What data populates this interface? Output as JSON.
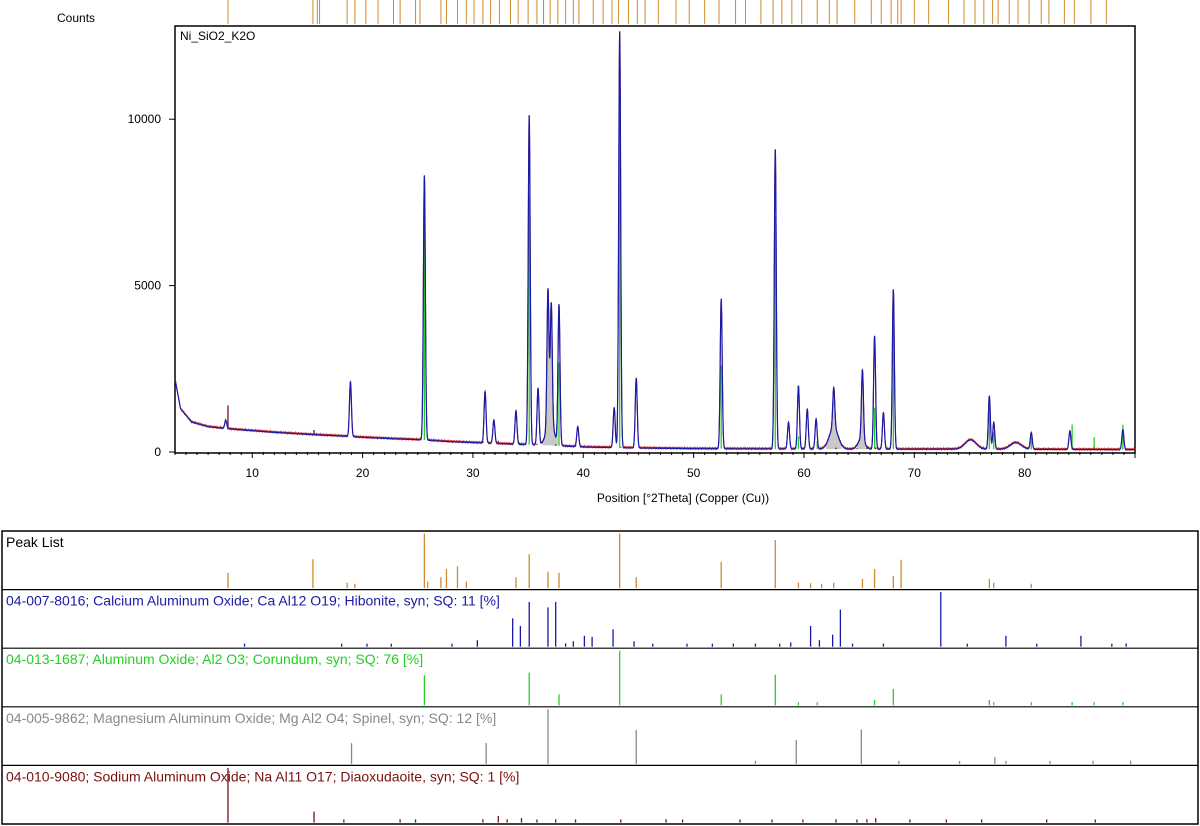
{
  "chart_data": {
    "type": "line",
    "title": "Ni_SiO2_K2O",
    "ylabel": "Counts",
    "xlabel": "Position [°2Theta] (Copper (Cu))",
    "xlim": [
      3,
      90
    ],
    "ylim": [
      0,
      12800
    ],
    "xticks": [
      10,
      20,
      30,
      40,
      50,
      60,
      70,
      80
    ],
    "yticks": [
      0,
      5000,
      10000
    ],
    "grid": false,
    "colors": {
      "peak_list": "#d08a2a",
      "hibonite": "#1a1aa8",
      "corundum": "#22d122",
      "spinel": "#888888",
      "diaoxudaoite": "#7a1010",
      "frame": "#000000"
    },
    "series": [
      {
        "name": "",
        "baseline": [
          [
            3,
            2200
          ],
          [
            3.5,
            1300
          ],
          [
            4.5,
            900
          ],
          [
            6,
            760
          ],
          [
            8,
            690
          ],
          [
            10,
            640
          ],
          [
            12,
            590
          ],
          [
            15,
            530
          ],
          [
            18,
            480
          ],
          [
            20,
            440
          ],
          [
            23,
            395
          ],
          [
            25,
            370
          ],
          [
            28,
            310
          ],
          [
            31,
            270
          ],
          [
            34,
            230
          ],
          [
            37,
            200
          ],
          [
            40,
            150
          ],
          [
            45,
            120
          ],
          [
            50,
            100
          ],
          [
            55,
            95
          ],
          [
            60,
            90
          ],
          [
            65,
            85
          ],
          [
            70,
            85
          ],
          [
            75,
            85
          ],
          [
            80,
            80
          ],
          [
            85,
            75
          ],
          [
            90,
            70
          ]
        ],
        "peaks": [
          [
            7.6,
            250
          ],
          [
            18.9,
            1650
          ],
          [
            25.6,
            7950
          ],
          [
            31.1,
            1550
          ],
          [
            31.9,
            700
          ],
          [
            33.9,
            1000
          ],
          [
            35.1,
            9900
          ],
          [
            35.9,
            1700
          ],
          [
            36.8,
            4100
          ],
          [
            37.1,
            3600
          ],
          [
            37.8,
            4200
          ],
          [
            39.5,
            600
          ],
          [
            42.8,
            1200
          ],
          [
            43.3,
            12500
          ],
          [
            44.8,
            2100
          ],
          [
            52.5,
            4500
          ],
          [
            57.4,
            9000
          ],
          [
            58.6,
            800
          ],
          [
            59.5,
            1900
          ],
          [
            60.3,
            1200
          ],
          [
            61.1,
            900
          ],
          [
            62.7,
            1200
          ],
          [
            65.3,
            2100
          ],
          [
            66.4,
            3400
          ],
          [
            67.2,
            1100
          ],
          [
            68.1,
            4800
          ],
          [
            76.8,
            1600
          ],
          [
            77.2,
            800
          ],
          [
            80.6,
            500
          ],
          [
            84.1,
            550
          ],
          [
            88.9,
            600
          ]
        ]
      }
    ],
    "peak_list_top": [
      7.8,
      15.5,
      15.9,
      16.1,
      18.6,
      19.3,
      20.3,
      21.4,
      22.8,
      23.4,
      24.8,
      25.2,
      27.1,
      27.6,
      28.6,
      29.4,
      30.1,
      30.9,
      31.6,
      32.4,
      33.4,
      34.1,
      35.0,
      35.8,
      36.4,
      37.0,
      37.7,
      38.4,
      39.1,
      39.6,
      40.9,
      41.8,
      42.6,
      43.2,
      44.1,
      44.9,
      45.6,
      46.8,
      48.4,
      49.6,
      51.0,
      52.3,
      53.8,
      54.7,
      56.1,
      57.2,
      58.0,
      58.9,
      59.8,
      61.2,
      62.3,
      63.0,
      64.6,
      66.1,
      67.0,
      67.9,
      68.5,
      68.8,
      70.0,
      71.3,
      73.1,
      74.5,
      75.5,
      76.3,
      77.1,
      77.6,
      78.6,
      79.4,
      80.4,
      81.5,
      82.2,
      83.6,
      84.5,
      86.0,
      87.4
    ],
    "reference_panels": [
      {
        "label": "Peak List",
        "color": "#d08a2a",
        "sticks": [
          [
            7.8,
            0.28
          ],
          [
            15.5,
            0.53
          ],
          [
            18.6,
            0.1
          ],
          [
            19.3,
            0.08
          ],
          [
            25.6,
            1.0
          ],
          [
            25.9,
            0.12
          ],
          [
            27.1,
            0.2
          ],
          [
            27.6,
            0.35
          ],
          [
            28.6,
            0.4
          ],
          [
            29.4,
            0.12
          ],
          [
            33.9,
            0.2
          ],
          [
            35.1,
            0.62
          ],
          [
            36.8,
            0.3
          ],
          [
            37.8,
            0.28
          ],
          [
            43.3,
            1.0
          ],
          [
            44.8,
            0.2
          ],
          [
            52.5,
            0.48
          ],
          [
            57.4,
            0.88
          ],
          [
            59.5,
            0.1
          ],
          [
            60.6,
            0.09
          ],
          [
            61.6,
            0.08
          ],
          [
            62.7,
            0.1
          ],
          [
            65.3,
            0.17
          ],
          [
            66.4,
            0.35
          ],
          [
            68.1,
            0.22
          ],
          [
            68.8,
            0.52
          ],
          [
            76.8,
            0.17
          ],
          [
            77.2,
            0.1
          ],
          [
            80.6,
            0.08
          ]
        ]
      },
      {
        "label": "04-007-8016; Calcium Aluminum Oxide; Ca Al12 O19; Hibonite, syn; SQ: 11 [%]",
        "color": "#1a1aa8",
        "sticks": [
          [
            9.3,
            0.03
          ],
          [
            18.1,
            0.03
          ],
          [
            20.4,
            0.05
          ],
          [
            22.6,
            0.03
          ],
          [
            28.1,
            0.05
          ],
          [
            30.4,
            0.12
          ],
          [
            33.6,
            0.52
          ],
          [
            34.3,
            0.38
          ],
          [
            35.1,
            0.82
          ],
          [
            36.8,
            0.72
          ],
          [
            37.5,
            0.82
          ],
          [
            38.4,
            0.06
          ],
          [
            39.1,
            0.1
          ],
          [
            40.1,
            0.2
          ],
          [
            40.8,
            0.18
          ],
          [
            42.7,
            0.32
          ],
          [
            44.6,
            0.1
          ],
          [
            46.3,
            0.05
          ],
          [
            49.4,
            0.05
          ],
          [
            51.7,
            0.05
          ],
          [
            53.6,
            0.04
          ],
          [
            55.6,
            0.03
          ],
          [
            57.8,
            0.05
          ],
          [
            58.8,
            0.08
          ],
          [
            60.6,
            0.38
          ],
          [
            61.4,
            0.12
          ],
          [
            62.6,
            0.22
          ],
          [
            63.3,
            0.68
          ],
          [
            64.4,
            0.05
          ],
          [
            67.2,
            0.05
          ],
          [
            72.4,
            1.0
          ],
          [
            74.8,
            0.03
          ],
          [
            78.3,
            0.2
          ],
          [
            81.1,
            0.04
          ],
          [
            85.1,
            0.2
          ],
          [
            87.9,
            0.03
          ],
          [
            89.2,
            0.06
          ]
        ]
      },
      {
        "label": "04-013-1687; Aluminum Oxide; Al2 O3; Corundum, syn; SQ: 76 [%]",
        "color": "#22d122",
        "sticks": [
          [
            25.6,
            0.55
          ],
          [
            35.1,
            0.6
          ],
          [
            37.8,
            0.2
          ],
          [
            43.3,
            1.0
          ],
          [
            52.5,
            0.2
          ],
          [
            57.4,
            0.56
          ],
          [
            59.5,
            0.03
          ],
          [
            61.2,
            0.02
          ],
          [
            66.4,
            0.1
          ],
          [
            68.1,
            0.3
          ],
          [
            76.8,
            0.1
          ],
          [
            77.2,
            0.04
          ],
          [
            80.6,
            0.03
          ],
          [
            84.3,
            0.06
          ],
          [
            86.3,
            0.03
          ],
          [
            88.9,
            0.06
          ]
        ]
      },
      {
        "label": "04-005-9862; Magnesium Aluminum Oxide; Mg Al2 O4; Spinel, syn; SQ: 12 [%]",
        "color": "#888888",
        "sticks": [
          [
            19.0,
            0.38
          ],
          [
            31.2,
            0.38
          ],
          [
            36.8,
            1.0
          ],
          [
            44.8,
            0.62
          ],
          [
            55.6,
            0.05
          ],
          [
            59.3,
            0.44
          ],
          [
            65.2,
            0.63
          ],
          [
            68.6,
            0.04
          ],
          [
            74.1,
            0.05
          ],
          [
            77.3,
            0.12
          ],
          [
            78.3,
            0.04
          ],
          [
            82.3,
            0.05
          ],
          [
            86.2,
            0.02
          ],
          [
            89.6,
            0.06
          ]
        ]
      },
      {
        "label": "04-010-9080; Sodium Aluminum Oxide; Na Al11 O17; Diaoxudaoite, syn; SQ: 1 [%]",
        "color": "#7a1010",
        "sticks": [
          [
            7.8,
            1.0
          ],
          [
            15.6,
            0.2
          ],
          [
            18.3,
            0.05
          ],
          [
            23.4,
            0.06
          ],
          [
            24.8,
            0.04
          ],
          [
            30.9,
            0.06
          ],
          [
            32.3,
            0.12
          ],
          [
            33.1,
            0.06
          ],
          [
            34.4,
            0.08
          ],
          [
            35.8,
            0.05
          ],
          [
            37.5,
            0.06
          ],
          [
            39.3,
            0.05
          ],
          [
            43.4,
            0.04
          ],
          [
            47.5,
            0.06
          ],
          [
            49.0,
            0.04
          ],
          [
            54.2,
            0.04
          ],
          [
            57.1,
            0.05
          ],
          [
            59.9,
            0.05
          ],
          [
            62.9,
            0.06
          ],
          [
            64.8,
            0.04
          ],
          [
            65.7,
            0.06
          ],
          [
            66.5,
            0.08
          ],
          [
            69.6,
            0.05
          ],
          [
            72.9,
            0.05
          ],
          [
            76.1,
            0.04
          ],
          [
            82.0,
            0.05
          ],
          [
            86.4,
            0.04
          ]
        ]
      }
    ]
  }
}
